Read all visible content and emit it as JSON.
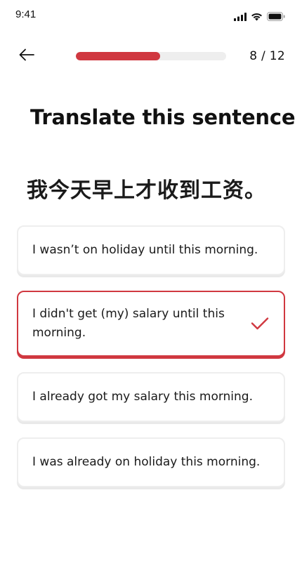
{
  "status_bar": {
    "time": "9:41",
    "icons": [
      "signal-icon",
      "wifi-icon",
      "battery-icon"
    ]
  },
  "header": {
    "back_icon": "back-arrow-icon",
    "progress": {
      "current": 8,
      "total": 12,
      "fill_fraction": 0.56
    },
    "counter_text": "8 / 12"
  },
  "title": "Translate this sentence",
  "prompt": "我今天早上才收到工资。",
  "options": [
    {
      "text": "I wasn’t on holiday until this morning.",
      "selected": false
    },
    {
      "text": "I didn't get (my) salary until this morning.",
      "selected": true
    },
    {
      "text": "I already got my salary this morning.",
      "selected": false
    },
    {
      "text": "I was already on holiday this morning.",
      "selected": false
    }
  ],
  "colors": {
    "accent": "#d03840",
    "track": "#eeeeee",
    "card_border": "#eeeeee"
  }
}
